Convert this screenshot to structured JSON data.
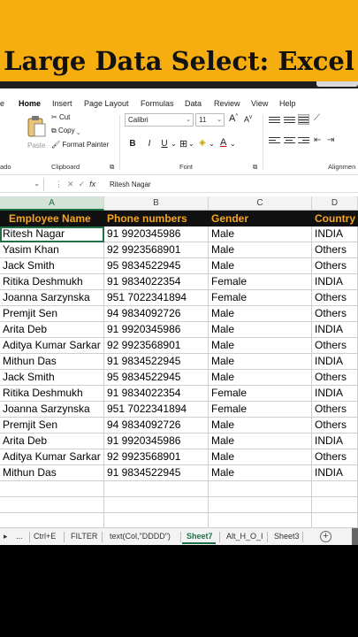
{
  "banner": {
    "title": "Large Data Select: Excel",
    "color": "#f5ad0f"
  },
  "ribbon_tabs": [
    "e",
    "Home",
    "Insert",
    "Page Layout",
    "Formulas",
    "Data",
    "Review",
    "View",
    "Help"
  ],
  "ribbon": {
    "paste_label": "Paste",
    "cut_label": "Cut",
    "copy_label": "Copy",
    "format_painter_label": "Format Painter",
    "clipboard_group": "Clipboard",
    "undo_group": "ado",
    "font_name": "Calibri",
    "font_size": "11",
    "font_group": "Font",
    "alignment_group": "Alignmen",
    "bold": "B",
    "italic": "I",
    "underline": "U",
    "grow_font": "A",
    "shrink_font": "A"
  },
  "formula_bar": {
    "fx": "fx",
    "value": "Ritesh Nagar"
  },
  "columns": [
    "A",
    "B",
    "C",
    "D"
  ],
  "selected_column": "A",
  "headers": [
    "Employee Name",
    "Phone numbers",
    "Gender",
    "Country"
  ],
  "rows": [
    [
      "Ritesh Nagar",
      "91 9920345986",
      "Male",
      "INDIA"
    ],
    [
      "Yasim Khan",
      "92 9923568901",
      "Male",
      "Others"
    ],
    [
      "Jack Smith",
      "95 9834522945",
      "Male",
      "Others"
    ],
    [
      "Ritika Deshmukh",
      "91 9834022354",
      "Female",
      "INDIA"
    ],
    [
      "Joanna Sarzynska",
      "951 7022341894",
      "Female",
      "Others"
    ],
    [
      "Premjit Sen",
      "94 9834092726",
      "Male",
      "Others"
    ],
    [
      "Arita Deb",
      "91 9920345986",
      "Male",
      "INDIA"
    ],
    [
      "Aditya Kumar Sarkar",
      "92 9923568901",
      "Male",
      "Others"
    ],
    [
      "Mithun Das",
      "91 9834522945",
      "Male",
      "INDIA"
    ],
    [
      "Jack Smith",
      "95 9834522945",
      "Male",
      "Others"
    ],
    [
      "Ritika Deshmukh",
      "91 9834022354",
      "Female",
      "INDIA"
    ],
    [
      "Joanna Sarzynska",
      "951 7022341894",
      "Female",
      "Others"
    ],
    [
      "Premjit Sen",
      "94 9834092726",
      "Male",
      "Others"
    ],
    [
      "Arita Deb",
      "91 9920345986",
      "Male",
      "INDIA"
    ],
    [
      "Aditya Kumar Sarkar",
      "92 9923568901",
      "Male",
      "Others"
    ],
    [
      "Mithun Das",
      "91 9834522945",
      "Male",
      "INDIA"
    ],
    [
      "",
      "",
      "",
      ""
    ],
    [
      "",
      "",
      "",
      ""
    ],
    [
      "",
      "",
      "",
      ""
    ]
  ],
  "sheet_tabs": [
    "...",
    "Ctrl+E",
    "FILTER",
    "text(Col,\"DDDD\")",
    "Sheet7",
    "Alt_H_O_I",
    "Sheet3"
  ],
  "active_sheet": "Sheet7",
  "accent_color": "#1e7145",
  "header_text_color": "#f5a623"
}
